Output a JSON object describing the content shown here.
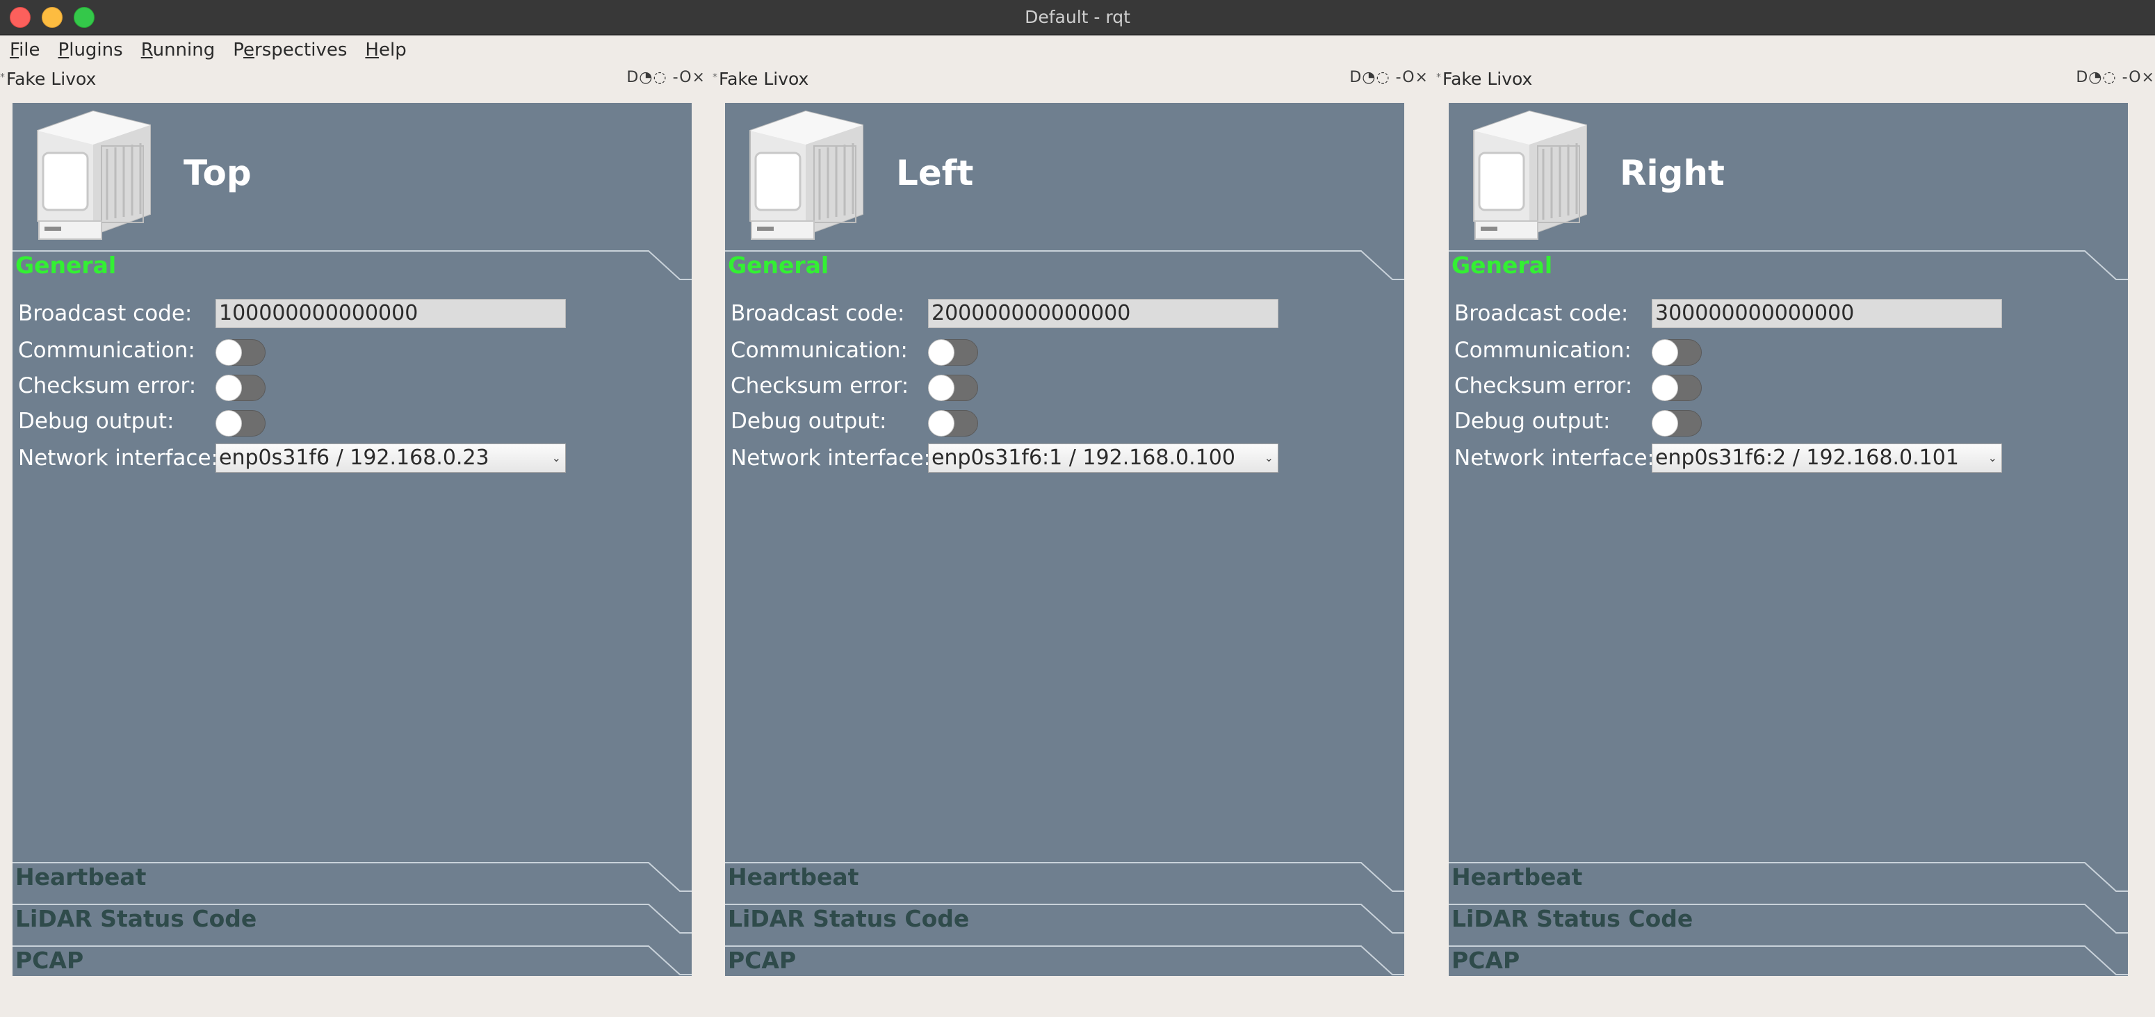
{
  "window": {
    "title": "Default - rqt"
  },
  "menu": [
    {
      "key": "F",
      "rest": "ile"
    },
    {
      "key": "P",
      "rest": "lugins"
    },
    {
      "key": "R",
      "rest": "unning"
    },
    {
      "key": "P",
      "rest": "erspectives",
      "prefix": ""
    },
    {
      "key": "H",
      "rest": "elp"
    }
  ],
  "menu_labels": {
    "file_u": "F",
    "file_rest": "ile",
    "plugins_u": "P",
    "plugins_rest": "lugins",
    "running_u": "R",
    "running_rest": "unning",
    "persp_pre": "P",
    "persp_u": "e",
    "persp_rest": "rspectives",
    "help_u": "H",
    "help_rest": "elp"
  },
  "dock_buttons": "D◔◌ -O×",
  "panels": [
    {
      "dock_title": "Fake Livox",
      "title": "Top",
      "general_label": "General",
      "broadcast_label": "Broadcast code:",
      "broadcast_value": "100000000000000",
      "communication_label": "Communication:",
      "checksum_label": "Checksum error:",
      "debug_label": "Debug output:",
      "network_label": "Network interface:",
      "network_value": "enp0s31f6 / 192.168.0.23",
      "heartbeat_label": "Heartbeat",
      "status_label": "LiDAR Status Code",
      "pcap_label": "PCAP"
    },
    {
      "dock_title": "Fake Livox",
      "title": "Left",
      "general_label": "General",
      "broadcast_label": "Broadcast code:",
      "broadcast_value": "200000000000000",
      "communication_label": "Communication:",
      "checksum_label": "Checksum error:",
      "debug_label": "Debug output:",
      "network_label": "Network interface:",
      "network_value": "enp0s31f6:1 / 192.168.0.100",
      "heartbeat_label": "Heartbeat",
      "status_label": "LiDAR Status Code",
      "pcap_label": "PCAP"
    },
    {
      "dock_title": "Fake Livox",
      "title": "Right",
      "general_label": "General",
      "broadcast_label": "Broadcast code:",
      "broadcast_value": "300000000000000",
      "communication_label": "Communication:",
      "checksum_label": "Checksum error:",
      "debug_label": "Debug output:",
      "network_label": "Network interface:",
      "network_value": "enp0s31f6:2 / 192.168.0.101",
      "heartbeat_label": "Heartbeat",
      "status_label": "LiDAR Status Code",
      "pcap_label": "PCAP"
    }
  ],
  "toggles": {
    "communication": false,
    "checksum_error": false,
    "debug_output": false
  },
  "colors": {
    "panel_bg": "#6f7f8f",
    "general_header": "#33f033",
    "collapsed_header": "#2f4b4b",
    "window_bg": "#efebe7"
  }
}
